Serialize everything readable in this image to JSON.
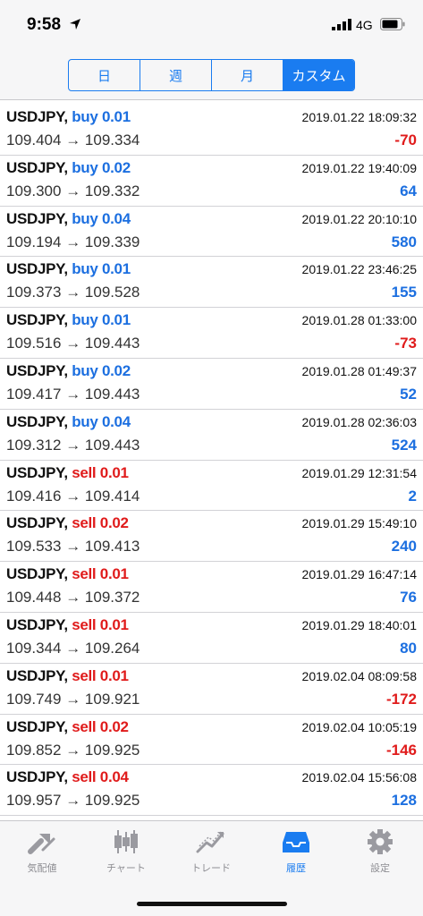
{
  "status_bar": {
    "time": "9:58",
    "network": "4G"
  },
  "segments": [
    {
      "label": "日",
      "active": false
    },
    {
      "label": "週",
      "active": false
    },
    {
      "label": "月",
      "active": false
    },
    {
      "label": "カスタム",
      "active": true
    }
  ],
  "trades": [
    {
      "symbol": "USDJPY,",
      "side": "buy",
      "size": "0.01",
      "time": "2019.01.22 18:09:32",
      "open": "109.404",
      "close": "109.334",
      "profit": "-70"
    },
    {
      "symbol": "USDJPY,",
      "side": "buy",
      "size": "0.02",
      "time": "2019.01.22 19:40:09",
      "open": "109.300",
      "close": "109.332",
      "profit": "64"
    },
    {
      "symbol": "USDJPY,",
      "side": "buy",
      "size": "0.04",
      "time": "2019.01.22 20:10:10",
      "open": "109.194",
      "close": "109.339",
      "profit": "580"
    },
    {
      "symbol": "USDJPY,",
      "side": "buy",
      "size": "0.01",
      "time": "2019.01.22 23:46:25",
      "open": "109.373",
      "close": "109.528",
      "profit": "155"
    },
    {
      "symbol": "USDJPY,",
      "side": "buy",
      "size": "0.01",
      "time": "2019.01.28 01:33:00",
      "open": "109.516",
      "close": "109.443",
      "profit": "-73"
    },
    {
      "symbol": "USDJPY,",
      "side": "buy",
      "size": "0.02",
      "time": "2019.01.28 01:49:37",
      "open": "109.417",
      "close": "109.443",
      "profit": "52"
    },
    {
      "symbol": "USDJPY,",
      "side": "buy",
      "size": "0.04",
      "time": "2019.01.28 02:36:03",
      "open": "109.312",
      "close": "109.443",
      "profit": "524"
    },
    {
      "symbol": "USDJPY,",
      "side": "sell",
      "size": "0.01",
      "time": "2019.01.29 12:31:54",
      "open": "109.416",
      "close": "109.414",
      "profit": "2"
    },
    {
      "symbol": "USDJPY,",
      "side": "sell",
      "size": "0.02",
      "time": "2019.01.29 15:49:10",
      "open": "109.533",
      "close": "109.413",
      "profit": "240"
    },
    {
      "symbol": "USDJPY,",
      "side": "sell",
      "size": "0.01",
      "time": "2019.01.29 16:47:14",
      "open": "109.448",
      "close": "109.372",
      "profit": "76"
    },
    {
      "symbol": "USDJPY,",
      "side": "sell",
      "size": "0.01",
      "time": "2019.01.29 18:40:01",
      "open": "109.344",
      "close": "109.264",
      "profit": "80"
    },
    {
      "symbol": "USDJPY,",
      "side": "sell",
      "size": "0.01",
      "time": "2019.02.04 08:09:58",
      "open": "109.749",
      "close": "109.921",
      "profit": "-172"
    },
    {
      "symbol": "USDJPY,",
      "side": "sell",
      "size": "0.02",
      "time": "2019.02.04 10:05:19",
      "open": "109.852",
      "close": "109.925",
      "profit": "-146"
    },
    {
      "symbol": "USDJPY,",
      "side": "sell",
      "size": "0.04",
      "time": "2019.02.04 15:56:08",
      "open": "109.957",
      "close": "109.925",
      "profit": "128"
    }
  ],
  "arrow": "→",
  "tabs": [
    {
      "label": "気配値",
      "icon": "quotes-icon",
      "active": false
    },
    {
      "label": "チャート",
      "icon": "chart-icon",
      "active": false
    },
    {
      "label": "トレード",
      "icon": "trade-icon",
      "active": false
    },
    {
      "label": "履歴",
      "icon": "history-icon",
      "active": true
    },
    {
      "label": "設定",
      "icon": "settings-icon",
      "active": false
    }
  ],
  "colors": {
    "accent": "#1a7cf0",
    "buy": "#1c6fe0",
    "sell": "#e01b1b",
    "inactive": "#8e8e93"
  }
}
